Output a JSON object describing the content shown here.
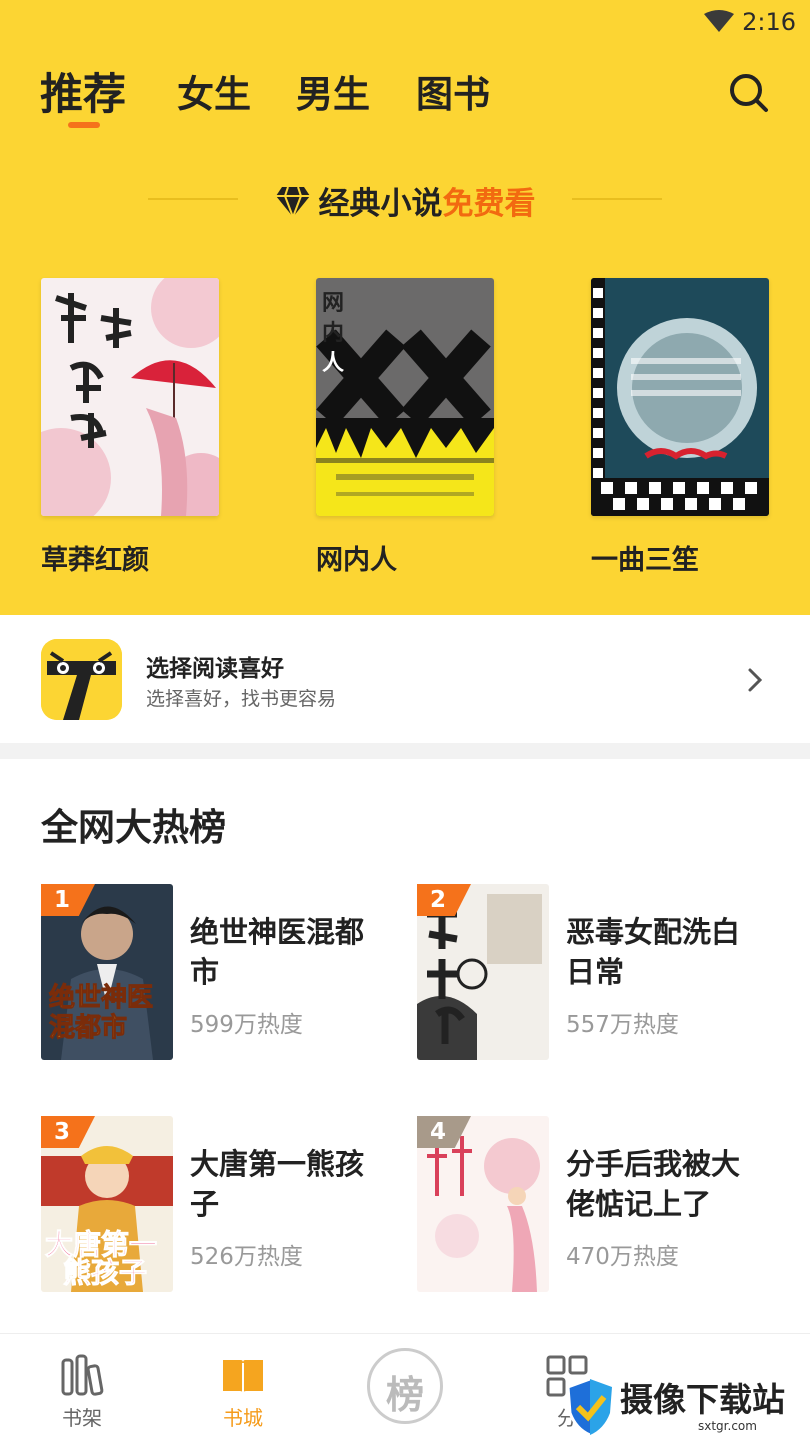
{
  "status": {
    "time": "2:16"
  },
  "tabs": [
    {
      "label": "推荐"
    },
    {
      "label": "女生"
    },
    {
      "label": "男生"
    },
    {
      "label": "图书"
    }
  ],
  "promo": {
    "text": "经典小说",
    "highlight": "免费看"
  },
  "featured_books": [
    {
      "title": "草莽红颜"
    },
    {
      "title": "网内人"
    },
    {
      "title": "一曲三笙"
    }
  ],
  "preference": {
    "title": "选择阅读喜好",
    "subtitle": "选择喜好，找书更容易"
  },
  "hot_list": {
    "title": "全网大热榜",
    "items": [
      {
        "rank": "1",
        "name": "绝世神医混都市",
        "heat": "599万热度"
      },
      {
        "rank": "2",
        "name": "恶毒女配洗白日常",
        "heat": "557万热度"
      },
      {
        "rank": "3",
        "name": "大唐第一熊孩子",
        "heat": "526万热度"
      },
      {
        "rank": "4",
        "name": "分手后我被大佬惦记上了",
        "heat": "470万热度"
      }
    ]
  },
  "bottom_nav": {
    "items": [
      {
        "label": "书架"
      },
      {
        "label": "书城"
      },
      {
        "label": "榜"
      },
      {
        "label": "分"
      }
    ]
  },
  "watermark": {
    "text": "摄像下载站",
    "url": "sxtgr.com"
  },
  "colors": {
    "accent": "#FCD533",
    "highlight": "#F26A10",
    "rank_badge": "#F5721B"
  }
}
